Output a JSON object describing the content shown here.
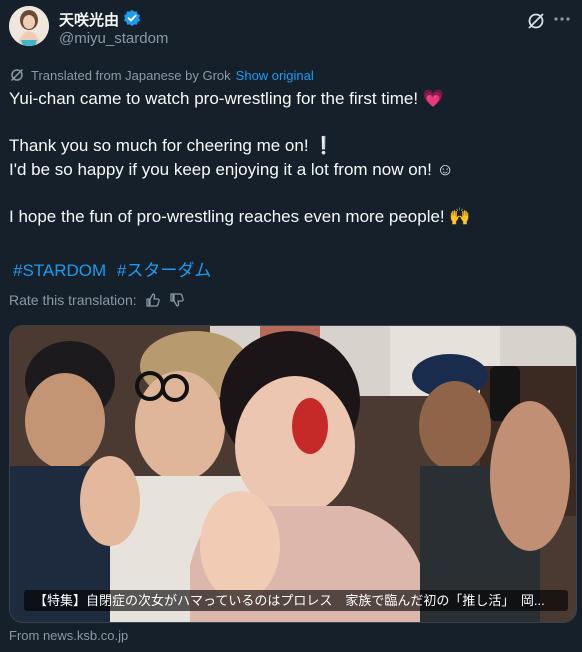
{
  "author": {
    "display_name": "天咲光由",
    "handle": "@miyu_stardom"
  },
  "translation": {
    "label": "Translated from Japanese by Grok",
    "show_original": "Show original"
  },
  "text": {
    "line1": "Yui-chan came to watch pro-wrestling for the first time! 💗",
    "line2": "Thank you so much for cheering me on! ❕",
    "line3": "I'd be so happy if you keep enjoying it a lot from now on! ☺",
    "line4": "I hope the fun of pro-wrestling reaches even more people! 🙌"
  },
  "hashtags": [
    "#STARDOM",
    "#スターダム"
  ],
  "rate": {
    "label": "Rate this translation:"
  },
  "media": {
    "caption": "【特集】自閉症の次女がハマっているのはプロレス　家族で臨んだ初の「推し活」　岡..."
  },
  "source": {
    "label": "From news.ksb.co.jp"
  },
  "colors": {
    "background": "#15202b",
    "accent": "#1d9bf0",
    "muted": "#8b98a5"
  },
  "icons": [
    "verified-badge-icon",
    "grok-icon",
    "more-icon",
    "thumbs-up-icon",
    "thumbs-down-icon"
  ]
}
